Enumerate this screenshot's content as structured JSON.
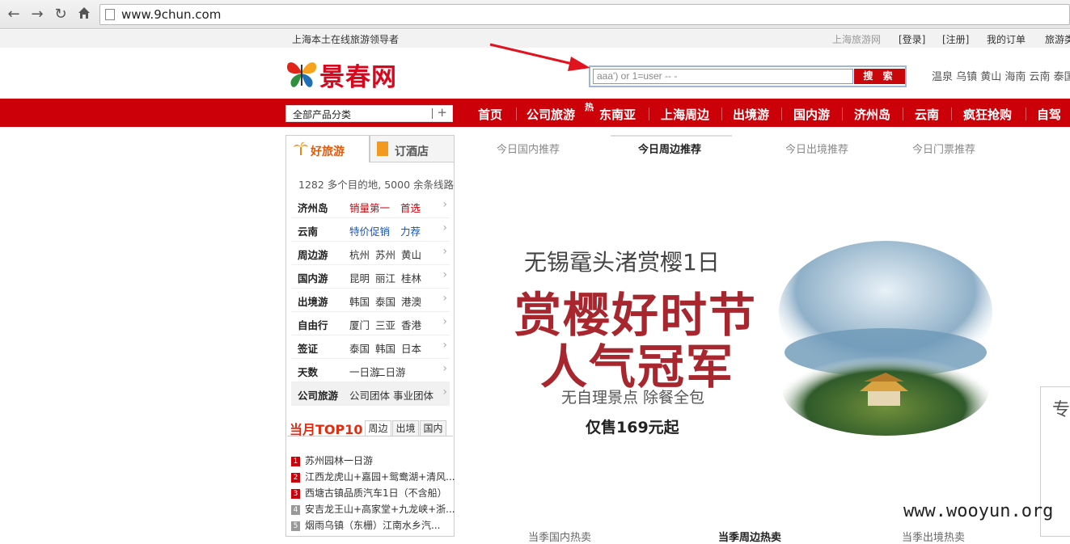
{
  "browser": {
    "url": "www.9chun.com"
  },
  "topbar": {
    "slogan": "上海本土在线旅游领导者",
    "site_link": "上海旅游网",
    "login": "[登录]",
    "register": "[注册]",
    "my_orders": "我的订单",
    "travel_cut": "旅游类"
  },
  "header": {
    "logo_text": "景春网",
    "search_value": "aaa') or 1=user -- -",
    "search_button": "搜 索",
    "hot_words": "温泉 乌镇 黄山 海南 云南 泰国 曲"
  },
  "nav": {
    "category_label": "全部产品分类",
    "category_plus": "+",
    "hot_badge": "热",
    "items": [
      "首页",
      "公司旅游",
      "东南亚",
      "上海周边",
      "出境游",
      "国内游",
      "济州岛",
      "云南",
      "疯狂抢购",
      "自驾"
    ]
  },
  "leftpanel": {
    "tab_travel": "好旅游",
    "tab_hotel": "订酒店",
    "summary": "1282 多个目的地, 5000 余条线路",
    "destinations": [
      {
        "cat": "济州岛",
        "links": [
          "销量第一",
          "首选"
        ]
      },
      {
        "cat": "云南",
        "links": [
          "特价促销",
          "力荐"
        ]
      },
      {
        "cat": "周边游",
        "links": [
          "杭州",
          "苏州",
          "黄山"
        ]
      },
      {
        "cat": "国内游",
        "links": [
          "昆明",
          "丽江",
          "桂林"
        ]
      },
      {
        "cat": "出境游",
        "links": [
          "韩国",
          "泰国",
          "港澳"
        ]
      },
      {
        "cat": "自由行",
        "links": [
          "厦门",
          "三亚",
          "香港"
        ]
      },
      {
        "cat": "签证",
        "links": [
          "泰国",
          "韩国",
          "日本"
        ]
      },
      {
        "cat": "天数",
        "links": [
          "一日游",
          "二日游"
        ]
      },
      {
        "cat": "公司旅游",
        "links": [
          "公司团体 事业团体"
        ]
      }
    ],
    "arrow": "›",
    "top10": {
      "title": "当月TOP10",
      "tabs": [
        "周边",
        "出境",
        "国内"
      ],
      "items": [
        {
          "rank": "1",
          "text": "苏州园林一日游"
        },
        {
          "rank": "2",
          "text": "江西龙虎山+嘉园+鸳鸯湖+清风..."
        },
        {
          "rank": "3",
          "text": "西塘古镇品质汽车1日（不含船）"
        },
        {
          "rank": "4",
          "text": "安吉龙王山+高家堂+九龙峡+浙..."
        },
        {
          "rank": "5",
          "text": "烟雨乌镇（东栅）江南水乡汽..."
        }
      ]
    }
  },
  "recommend_tabs": [
    "今日国内推荐",
    "今日周边推荐",
    "今日出境推荐",
    "今日门票推荐"
  ],
  "banner": {
    "subtitle": "无锡鼋头渚赏樱1日",
    "title_line1": "赏樱好时节",
    "title_line2": "人气冠军",
    "desc": "无自理景点 除餐全包",
    "price": "仅售169元起"
  },
  "bottom_headers": [
    "当季国内热卖",
    "当季周边热卖",
    "当季出境热卖"
  ],
  "side_widget": {
    "char": "专"
  },
  "watermark": "www.wooyun.org",
  "colors": {
    "brand_red": "#cc0008",
    "banner_red": "#a8262d",
    "search_blue": "#7a9cc8"
  },
  "icons": [
    "back-arrow-icon",
    "forward-arrow-icon",
    "reload-icon",
    "home-icon",
    "page-icon",
    "butterfly-logo-icon",
    "palm-tree-icon",
    "hotel-building-icon",
    "annotation-arrow-icon"
  ]
}
